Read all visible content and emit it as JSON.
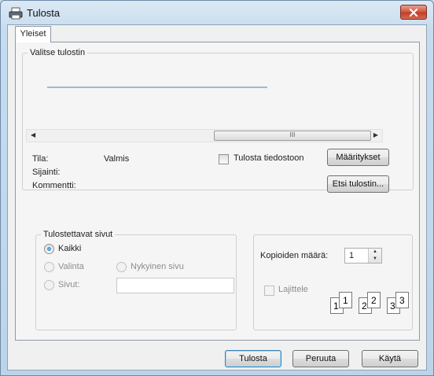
{
  "window": {
    "title": "Tulosta",
    "icon": "printer-icon"
  },
  "tabs": [
    {
      "label": "Yleiset",
      "selected": true
    }
  ],
  "printer_group": {
    "legend": "Valitse tulostin",
    "scroll_thumb_text": "III",
    "status_label": "Tila:",
    "status_value": "Valmis",
    "location_label": "Sijainti:",
    "comment_label": "Kommentti:",
    "print_to_file": {
      "label": "Tulosta tiedostoon",
      "checked": false
    },
    "preferences_button": "Määritykset",
    "find_printer_button": "Etsi tulostin..."
  },
  "page_range": {
    "legend": "Tulostettavat sivut",
    "all": {
      "label": "Kaikki",
      "selected": true
    },
    "selection": {
      "label": "Valinta",
      "enabled": false
    },
    "current_page": {
      "label": "Nykyinen sivu",
      "enabled": false
    },
    "pages": {
      "label": "Sivut:",
      "enabled": false,
      "value": ""
    }
  },
  "copies": {
    "label": "Kopioiden määrä:",
    "value": "1",
    "collate": {
      "label": "Lajittele",
      "checked": false,
      "enabled": false
    },
    "collate_pages": [
      "1",
      "1",
      "2",
      "2",
      "3",
      "3"
    ]
  },
  "footer": {
    "print_button": "Tulosta",
    "cancel_button": "Peruuta",
    "apply_button": "Käytä"
  }
}
